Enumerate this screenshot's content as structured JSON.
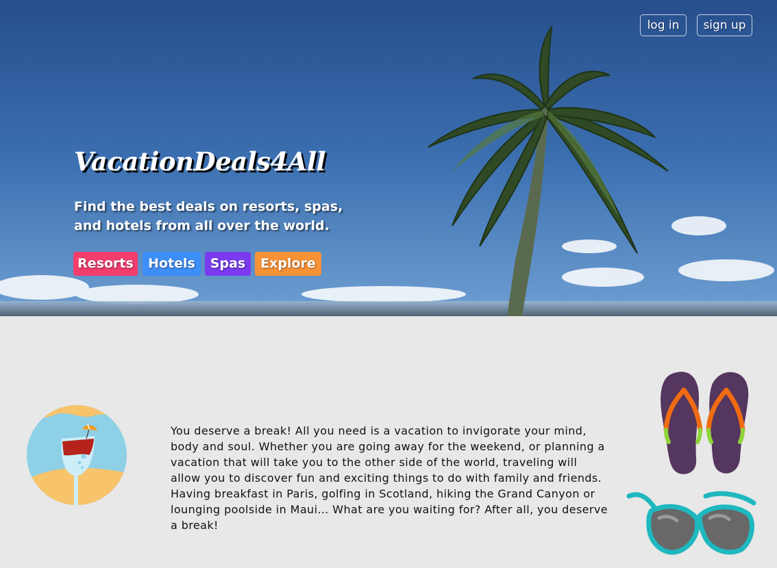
{
  "header": {
    "login_label": "log in",
    "signup_label": "sign up"
  },
  "hero": {
    "brand": "VacationDeals4All",
    "tagline_line1": "Find the best deals on resorts, spas,",
    "tagline_line2": "and hotels from all over the world.",
    "categories": [
      {
        "label": "Resorts",
        "color": "#f23d6d"
      },
      {
        "label": "Hotels",
        "color": "#3e8ef7"
      },
      {
        "label": "Spas",
        "color": "#7a3af0"
      },
      {
        "label": "Explore",
        "color": "#f79237"
      }
    ]
  },
  "main": {
    "intro_text": "You deserve a break! All you need is a vacation to invigorate your mind, body and soul. Whether you are going away for the weekend, or planning a vacation that will take you to the other side of the world, traveling will allow you to discover fun and exciting things to do with family and friends. Having breakfast in Paris, golfing in Scotland, hiking the Grand Canyon or lounging poolside in Maui… What are you waiting for? After all, you deserve a break!",
    "images": [
      "cocktail-icon",
      "flip-flops-icon",
      "sunglasses-icon"
    ]
  }
}
